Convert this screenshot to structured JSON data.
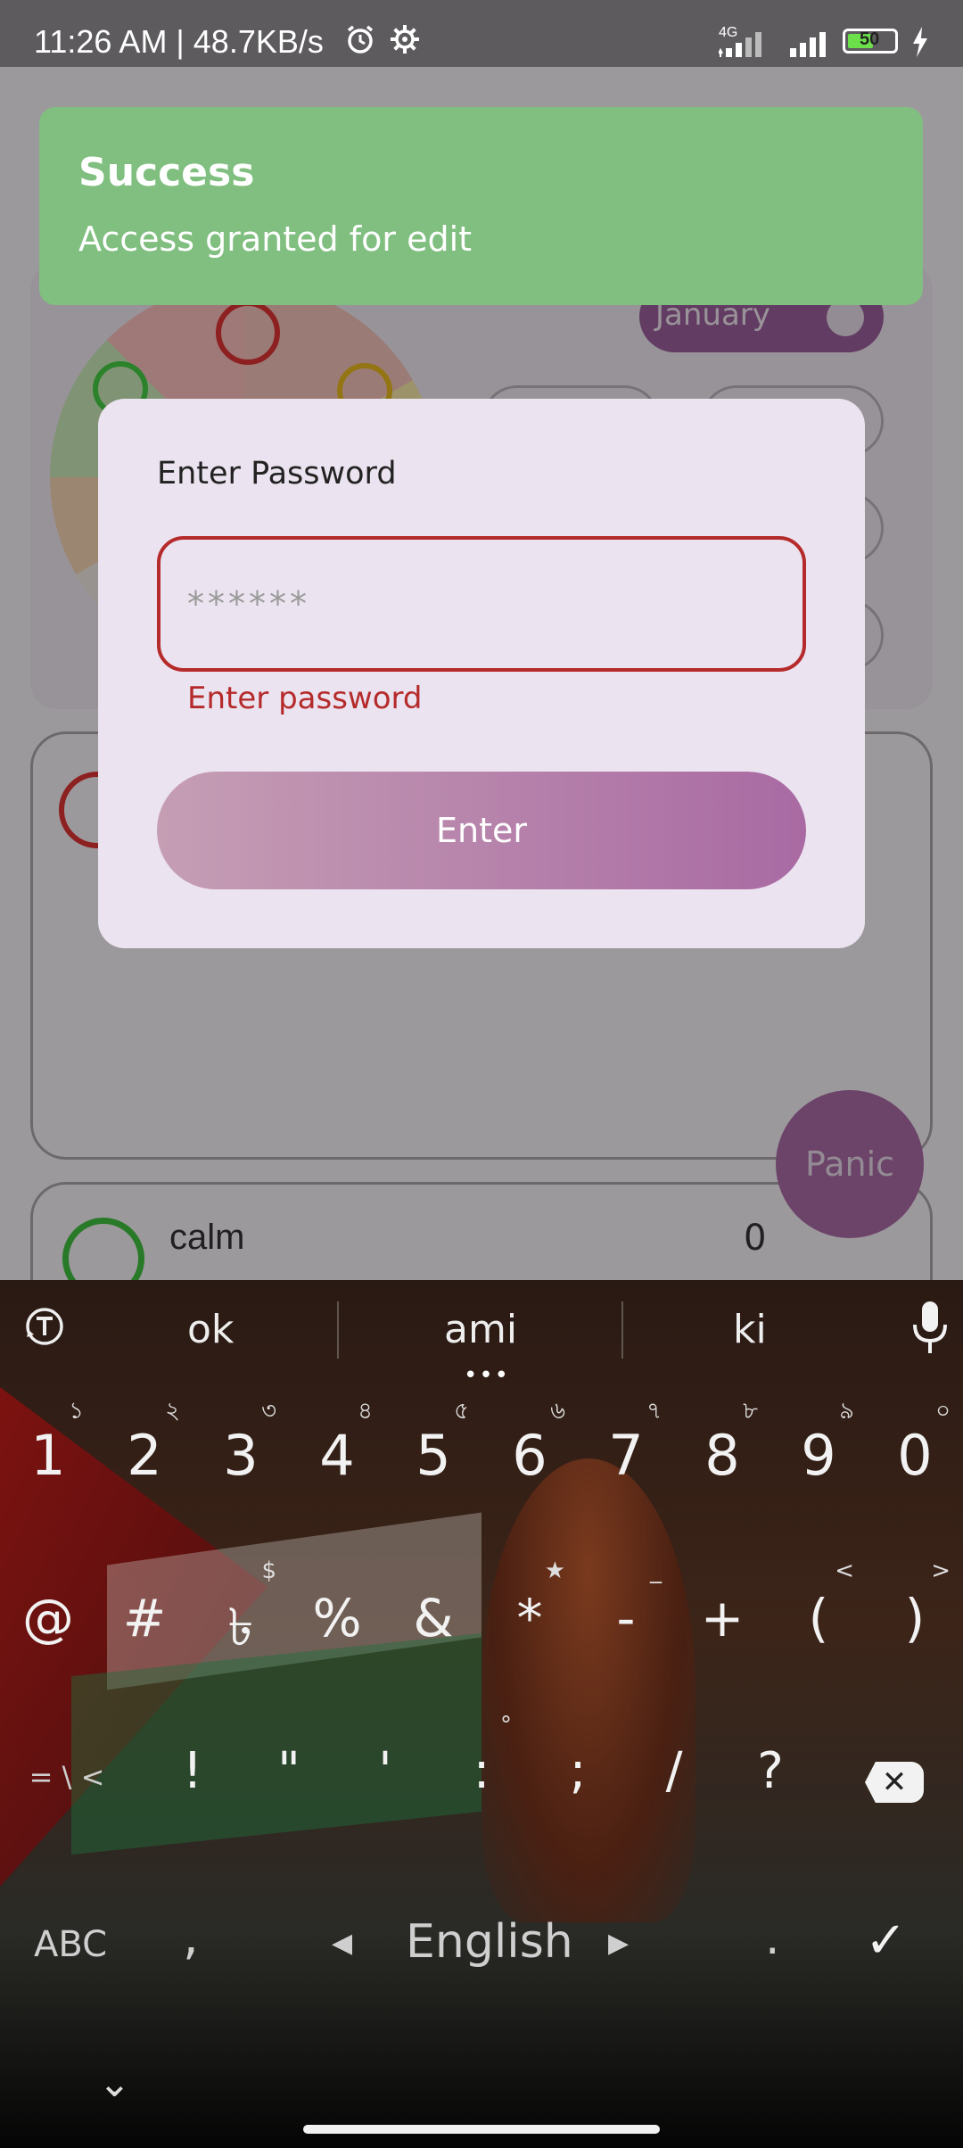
{
  "status_bar": {
    "time": "11:26 AM | 48.7KB/s",
    "network": "4G",
    "battery": "50"
  },
  "toast": {
    "title": "Success",
    "message": "Access granted for edit"
  },
  "background": {
    "month": "January",
    "mood_label": "calm",
    "mood_count": "0",
    "panic_label": "Panic"
  },
  "dialog": {
    "title": "Enter Password",
    "password_placeholder": "******",
    "error_text": "Enter password",
    "enter_label": "Enter"
  },
  "keyboard": {
    "suggestions": [
      "ok",
      "ami",
      "ki"
    ],
    "number_row": [
      {
        "key": "1",
        "hint": "১"
      },
      {
        "key": "2",
        "hint": "২"
      },
      {
        "key": "3",
        "hint": "৩"
      },
      {
        "key": "4",
        "hint": "৪"
      },
      {
        "key": "5",
        "hint": "৫"
      },
      {
        "key": "6",
        "hint": "৬"
      },
      {
        "key": "7",
        "hint": "৭"
      },
      {
        "key": "8",
        "hint": "৮"
      },
      {
        "key": "9",
        "hint": "৯"
      },
      {
        "key": "0",
        "hint": "০"
      }
    ],
    "symbol_row": [
      {
        "key": "@",
        "hint": ""
      },
      {
        "key": "#",
        "hint": ""
      },
      {
        "key": "৳",
        "hint": "$"
      },
      {
        "key": "%",
        "hint": ""
      },
      {
        "key": "&",
        "hint": ""
      },
      {
        "key": "*",
        "hint": "★"
      },
      {
        "key": "-",
        "hint": "_"
      },
      {
        "key": "+",
        "hint": ""
      },
      {
        "key": "(",
        "hint": "<"
      },
      {
        "key": ")",
        "hint": ">"
      }
    ],
    "punct_row": {
      "more": "= \\ <",
      "keys": [
        "!",
        "\"",
        "'",
        ":",
        ";",
        "/",
        "?"
      ],
      "hint_colon": "°"
    },
    "bottom_row": {
      "abc": "ABC",
      "comma": ",",
      "language": "English",
      "period": ".",
      "left_arrow": "◀",
      "right_arrow": "▶",
      "done": "✓"
    },
    "hide": "⌄"
  }
}
